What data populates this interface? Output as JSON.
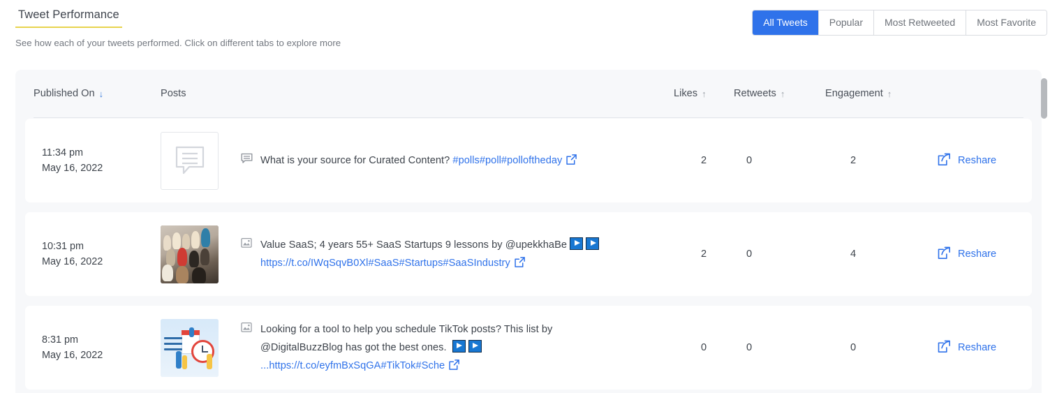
{
  "header": {
    "title": "Tweet Performance",
    "subtitle": "See how each of your tweets performed. Click on different tabs to explore more"
  },
  "tabs": [
    {
      "label": "All Tweets",
      "active": true
    },
    {
      "label": "Popular",
      "active": false
    },
    {
      "label": "Most Retweeted",
      "active": false
    },
    {
      "label": "Most Favorite",
      "active": false
    }
  ],
  "table": {
    "columns": [
      {
        "label": "Published On",
        "sort": "↓",
        "sort_color": "blue"
      },
      {
        "label": "Posts",
        "sort": "",
        "sort_color": ""
      },
      {
        "label": "Likes",
        "sort": "↑",
        "sort_color": "grey"
      },
      {
        "label": "Retweets",
        "sort": "↑",
        "sort_color": "grey"
      },
      {
        "label": "Engagement",
        "sort": "↑",
        "sort_color": "grey"
      }
    ],
    "rows": [
      {
        "time": "11:34 pm",
        "date": "May 16, 2022",
        "thumb_type": "placeholder-poll",
        "post_icon": "comment-icon",
        "text_plain": "What is your source for Curated Content? ",
        "hashtags": "#polls#poll#polloftheday",
        "link": "",
        "link_hashtags": "",
        "play_badges": 0,
        "likes": "2",
        "retweets": "0",
        "engagement": "2",
        "action_label": "Reshare"
      },
      {
        "time": "10:31 pm",
        "date": "May 16, 2022",
        "thumb_type": "photo-people",
        "post_icon": "image-icon",
        "text_plain": "Value SaaS; 4 years 55+ SaaS Startups 9 lessons by @upekkhaBe",
        "hashtags": "",
        "link": "https://t.co/IWqSqvB0Xl",
        "link_hashtags": "#SaaS#Startups#SaaSIndustry",
        "play_badges": 2,
        "likes": "2",
        "retweets": "0",
        "engagement": "4",
        "action_label": "Reshare"
      },
      {
        "time": "8:31 pm",
        "date": "May 16, 2022",
        "thumb_type": "illustration-schedule",
        "post_icon": "image-icon",
        "text_plain": "Looking for a tool to help you schedule TikTok posts? This list by @DigitalBuzzBlog has got the best ones. ",
        "hashtags": "",
        "link": "...https://t.co/eyfmBxSqGA",
        "link_hashtags": "#TikTok#Sche",
        "play_badges": 2,
        "likes": "0",
        "retweets": "0",
        "engagement": "0",
        "action_label": "Reshare"
      }
    ]
  },
  "colors": {
    "accent_blue": "#2f72ea",
    "title_underline": "#e8d44d",
    "text_dark": "#3d434b",
    "text_muted": "#72777f",
    "panel_bg": "#f7f8fa"
  }
}
